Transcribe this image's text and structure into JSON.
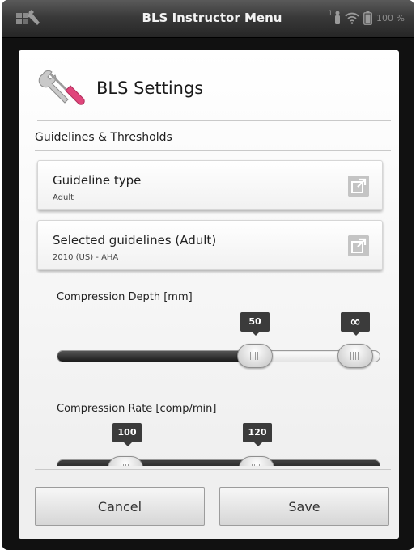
{
  "statusbar": {
    "title": "BLS Instructor Menu",
    "user_count": "1",
    "battery": "100 %"
  },
  "header": {
    "title": "BLS Settings",
    "icon": "wrench-screwdriver-icon"
  },
  "section": {
    "label": "Guidelines & Thresholds"
  },
  "cards": [
    {
      "title": "Guideline type",
      "value": "Adult",
      "icon": "open-external-icon"
    },
    {
      "title": "Selected guidelines (Adult)",
      "value": "2010 (US) - AHA",
      "icon": "open-external-icon"
    }
  ],
  "sliders": [
    {
      "label": "Compression Depth [mm]",
      "low_label": "50",
      "high_label": "∞"
    },
    {
      "label": "Compression Rate [comp/min]",
      "low_label": "100",
      "high_label": "120"
    }
  ],
  "footer": {
    "cancel_label": "Cancel",
    "save_label": "Save"
  },
  "colors": {
    "accent": "#e0457b",
    "value_tag": "#3b3b3b",
    "status_bar": "#3a3a3a"
  }
}
